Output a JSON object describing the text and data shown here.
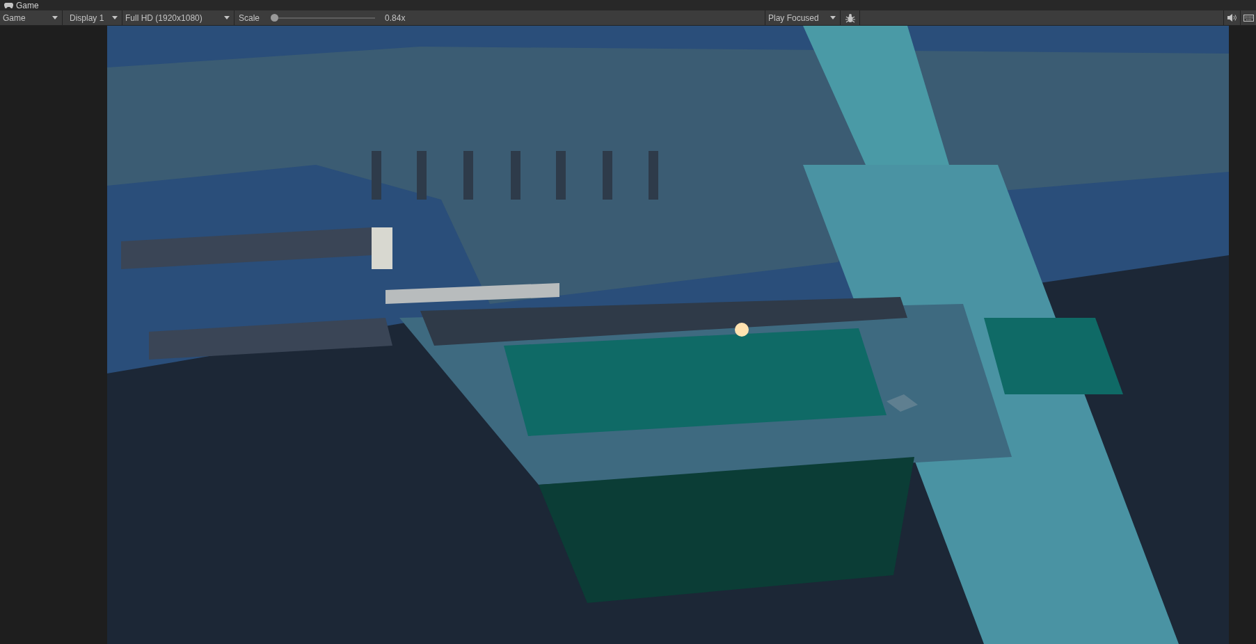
{
  "window": {
    "title": "Game"
  },
  "toolbar": {
    "view_dropdown": "Game",
    "display_dropdown": "Display 1",
    "resolution_dropdown": "Full HD (1920x1080)",
    "scale": {
      "label": "Scale",
      "level": 0,
      "reading": "0.84x"
    },
    "play_mode_dropdown": "Play Focused"
  }
}
